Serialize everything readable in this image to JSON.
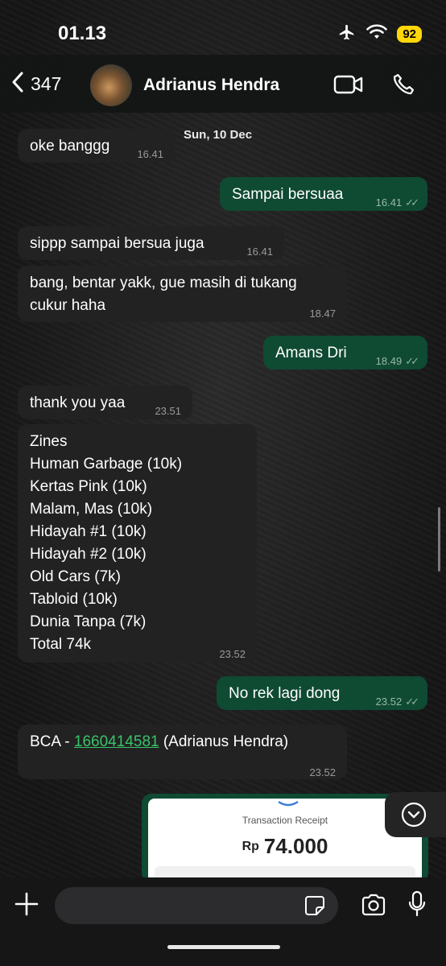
{
  "status_bar": {
    "time": "01.13",
    "battery": "92"
  },
  "header": {
    "back_count": "347",
    "contact_name": "Adrianus Hendra"
  },
  "chat": {
    "date_label": "Sun, 10 Dec",
    "messages": [
      {
        "text": "oke banggg",
        "time": "16.41"
      },
      {
        "text": "Sampai bersuaa",
        "time": "16.41"
      },
      {
        "text": "sippp sampai bersua juga",
        "time": "16.41"
      },
      {
        "lines": [
          "bang, bentar yakk, gue masih di tukang",
          "cukur haha"
        ],
        "time": "18.47"
      },
      {
        "text": "Amans Dri",
        "time": "18.49"
      },
      {
        "text": "thank you yaa",
        "time": "23.51"
      },
      {
        "lines": [
          "Zines",
          "Human Garbage (10k)",
          "Kertas Pink (10k)",
          "Malam, Mas (10k)",
          "Hidayah #1 (10k)",
          "Hidayah #2 (10k)",
          "Old Cars (7k)",
          "Tabloid (10k)",
          "Dunia Tanpa (7k)",
          "Total 74k"
        ],
        "time": "23.52"
      },
      {
        "text": "No rek lagi dong",
        "time": "23.52"
      },
      {
        "prefix": "BCA - ",
        "account": "1660414581",
        "suffix": " (Adrianus Hendra)",
        "time": "23.52"
      }
    ],
    "receipt": {
      "title": "Transaction Receipt",
      "currency": "Rp",
      "amount": "74.000"
    }
  },
  "composer": {
    "placeholder": ""
  },
  "colors": {
    "outgoing_bubble": "#0f4a33",
    "incoming_bubble": "#222222",
    "link": "#39c36a",
    "battery": "#ffd60a"
  },
  "icons": [
    "airplane-icon",
    "wifi-icon",
    "chevron-left-icon",
    "video-call-icon",
    "phone-icon",
    "chevron-down-icon",
    "plus-icon",
    "sticker-icon",
    "camera-icon",
    "microphone-icon"
  ]
}
